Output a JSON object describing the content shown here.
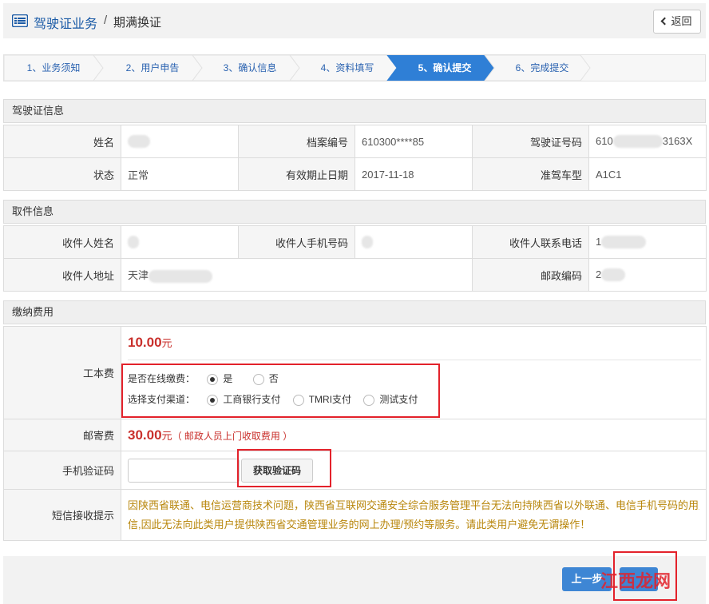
{
  "header": {
    "title": "驾驶证业务",
    "separator": "/",
    "subtitle": "期满换证",
    "back_label": "返回"
  },
  "steps": [
    {
      "label": "1、业务须知",
      "active": false
    },
    {
      "label": "2、用户申告",
      "active": false
    },
    {
      "label": "3、确认信息",
      "active": false
    },
    {
      "label": "4、资料填写",
      "active": false
    },
    {
      "label": "5、确认提交",
      "active": true
    },
    {
      "label": "6、完成提交",
      "active": false
    }
  ],
  "license_section": {
    "title": "驾驶证信息",
    "name_label": "姓名",
    "name_value": "",
    "file_no_label": "档案编号",
    "file_no_value": "610300****85",
    "license_no_label": "驾驶证号码",
    "license_no_prefix": "610",
    "license_no_suffix": "3163X",
    "status_label": "状态",
    "status_value": "正常",
    "expiry_label": "有效期止日期",
    "expiry_value": "2017-11-18",
    "vehicle_label": "准驾车型",
    "vehicle_value": "A1C1"
  },
  "pickup_section": {
    "title": "取件信息",
    "recipient_name_label": "收件人姓名",
    "recipient_phone_label": "收件人手机号码",
    "recipient_tel_label": "收件人联系电话",
    "recipient_tel_prefix": "1",
    "address_label": "收件人地址",
    "address_prefix": "天津",
    "postcode_label": "邮政编码",
    "postcode_prefix": "2"
  },
  "fee_section": {
    "title": "缴纳费用",
    "cost_label": "工本费",
    "cost_amount": "10.00",
    "cost_unit": "元",
    "online_pay_label": "是否在线缴费：",
    "online_yes": "是",
    "online_no": "否",
    "channel_label": "选择支付渠道：",
    "channel_options": [
      "工商银行支付",
      "TMRI支付",
      "测试支付"
    ],
    "postage_label": "邮寄费",
    "postage_amount": "30.00",
    "postage_unit": "元",
    "postage_note": "（ 邮政人员上门收取费用 ）",
    "sms_code_label": "手机验证码",
    "sms_code_button": "获取验证码",
    "sms_notice_label": "短信接收提示",
    "sms_notice_line1": "因陕西省联通、电信运营商技术问题，陕西省互联网交通安全综合服务管理平台无法向持陕西省以外联通、电信手机号码的用户发送短",
    "sms_notice_line2": "信,因此无法向此类用户提供陕西省交通管理业务的网上办理/预约等服务。请此类用户避免无谓操作！"
  },
  "footer": {
    "prev_label": "上一步"
  },
  "watermark": "江西龙网",
  "colors": {
    "brand_blue": "#3e86d4",
    "step_active": "#2f7fd6",
    "price_red": "#c9302c",
    "highlight_red": "#e3222b",
    "notice_gold": "#b8860b"
  }
}
